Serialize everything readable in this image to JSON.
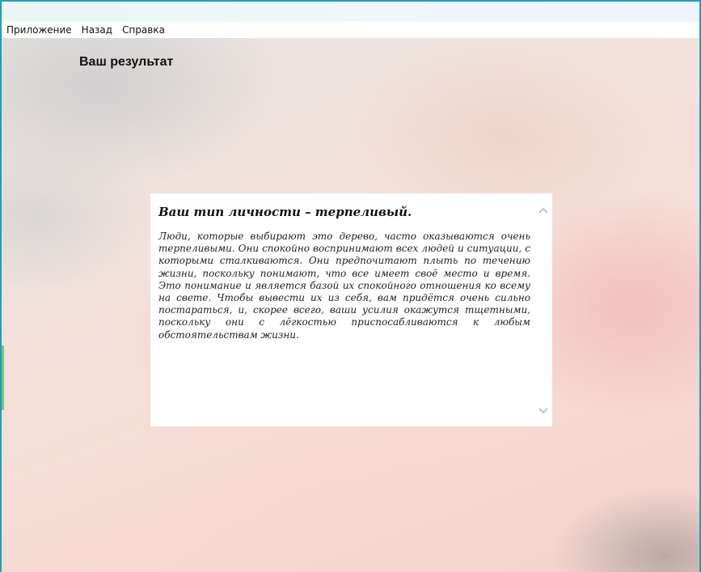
{
  "menu": {
    "items": [
      {
        "label": "Приложение"
      },
      {
        "label": "Назад"
      },
      {
        "label": "Справка"
      }
    ]
  },
  "page": {
    "title": "Ваш результат"
  },
  "result": {
    "heading": "Ваш тип личности – терпеливый.",
    "body": "Люди, которые выбирают это дерево, часто оказываются очень терпеливыми. Они спокойно воспринимают всех людей и ситуации, с которыми сталкиваются. Они предпочитают плыть по течению жизни, поскольку понимают, что все имеет своё место и время. Это понимание и является базой их спокойного отношения ко всему на свете. Чтобы вывести их из себя, вам придётся очень сильно постараться, и, скорее всего, ваши усилия окажутся тщетными, поскольку они с лёгкостью приспосабливаются к любым обстоятельствам жизни."
  },
  "icons": {
    "scroll_up": "chevron-up-icon",
    "scroll_down": "chevron-down-icon"
  },
  "colors": {
    "accent_titlebar": "#e9f6f4",
    "scroll_arrow": "#b8b8b8"
  }
}
